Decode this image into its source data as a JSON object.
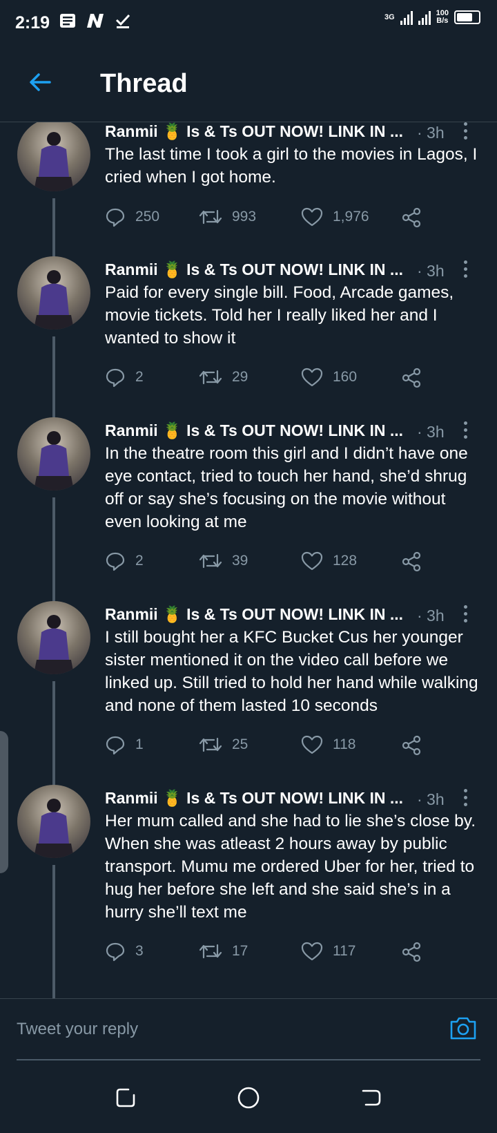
{
  "status_bar": {
    "time": "2:19",
    "network": "3G",
    "speed_value": "100",
    "speed_unit": "B/s"
  },
  "header": {
    "title": "Thread"
  },
  "tweets": [
    {
      "name": "Ranmii 🍍 Is & Ts OUT NOW! LINK IN ...",
      "time": "· 3h",
      "text": "The last time I took a girl to the movies in Lagos, I cried when I got home.",
      "replies": "250",
      "retweets": "993",
      "likes": "1,976"
    },
    {
      "name": "Ranmii 🍍 Is & Ts OUT NOW! LINK IN ...",
      "time": "· 3h",
      "text": "Paid for every single bill. Food, Arcade games, movie tickets. Told her I really liked her and I wanted to show it",
      "replies": "2",
      "retweets": "29",
      "likes": "160"
    },
    {
      "name": "Ranmii 🍍 Is & Ts OUT NOW! LINK IN ...",
      "time": "· 3h",
      "text": "In the theatre room this girl and I didn’t have one eye contact, tried to touch her hand, she’d shrug off or say she’s focusing on the movie without even looking at me",
      "replies": "2",
      "retweets": "39",
      "likes": "128"
    },
    {
      "name": "Ranmii 🍍 Is & Ts OUT NOW! LINK IN ...",
      "time": "· 3h",
      "text": "I still bought her a KFC Bucket Cus her younger sister mentioned it on the video call before we linked up. Still tried to hold her hand while walking and none of them lasted 10 seconds",
      "replies": "1",
      "retweets": "25",
      "likes": "118"
    },
    {
      "name": "Ranmii 🍍 Is & Ts OUT NOW! LINK IN ...",
      "time": "· 3h",
      "text": "Her mum called and she had to lie she’s close by. When she was atleast 2 hours away by public transport. Mumu me ordered Uber for her, tried to hug her before she left and she said she’s in a hurry she’ll text me",
      "replies": "3",
      "retweets": "17",
      "likes": "117"
    }
  ],
  "reply": {
    "placeholder": "Tweet your reply"
  },
  "icons": [
    "back-arrow-icon",
    "reply-icon",
    "retweet-icon",
    "like-icon",
    "share-icon",
    "more-icon",
    "camera-icon",
    "notes-icon",
    "n-logo-icon",
    "check-icon",
    "signal-icon",
    "battery-icon"
  ],
  "colors": {
    "background": "#15202b",
    "accent": "#1da1f2",
    "muted": "#8899a6",
    "divider": "#38444d"
  }
}
